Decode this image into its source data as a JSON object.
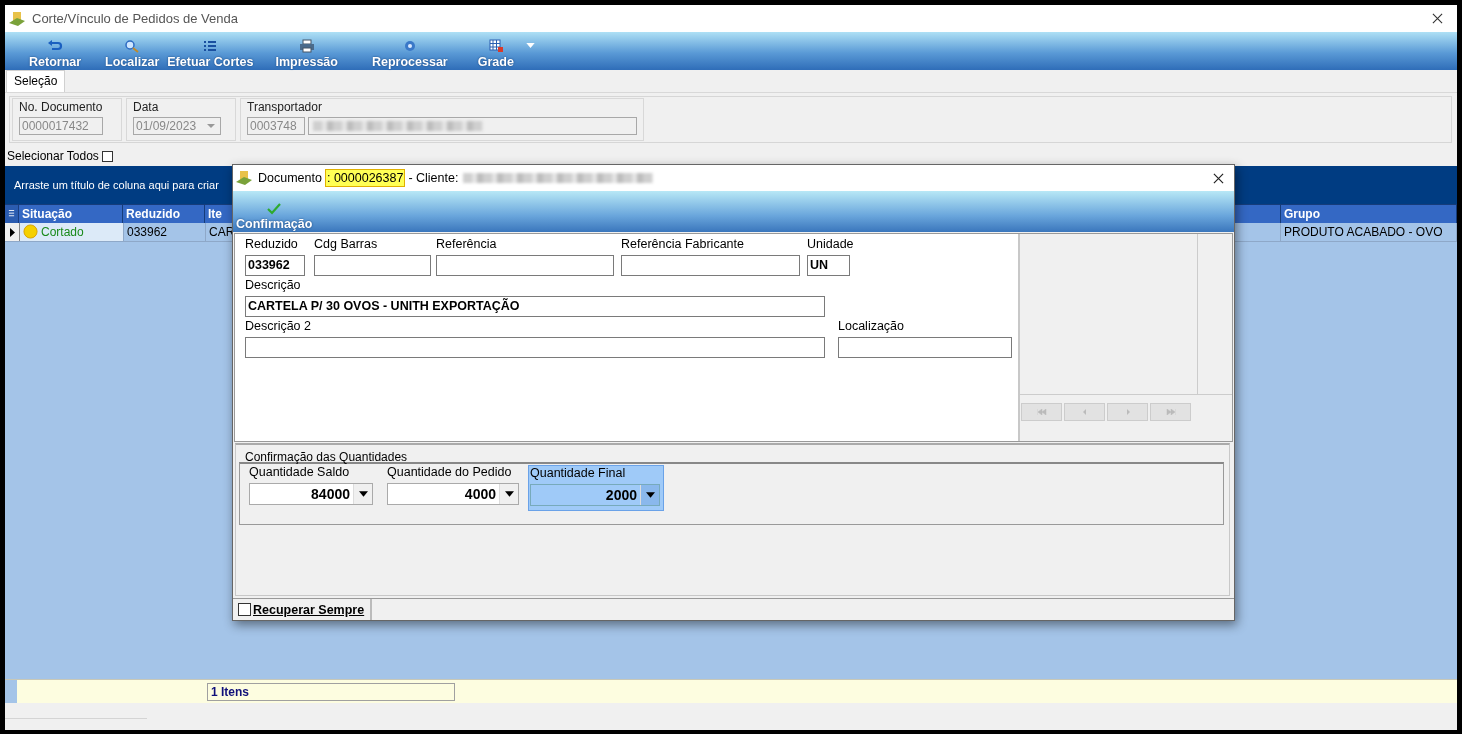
{
  "window": {
    "title": "Corte/Vínculo de Pedidos de Venda"
  },
  "toolbar": [
    {
      "label": "Retornar",
      "kind": "return"
    },
    {
      "label": "Localizar",
      "kind": "search"
    },
    {
      "label": "Efetuar Cortes",
      "kind": "list"
    },
    {
      "label": "Impressão",
      "kind": "print"
    },
    {
      "label": "Reprocessar",
      "kind": "gear"
    },
    {
      "label": "Grade",
      "kind": "grid"
    }
  ],
  "tabs": [
    {
      "label": "Seleção",
      "selected": true
    }
  ],
  "filters": {
    "disabled": true,
    "document": {
      "label": "No. Documento",
      "value": "0000017432"
    },
    "date": {
      "label": "Data",
      "value": "01/09/2023"
    },
    "carrier": {
      "label": "Transportador",
      "code": "0003748"
    }
  },
  "select_all": {
    "label": "Selecionar Todos",
    "checked": false
  },
  "group_hint": "Arraste um título de coluna aqui para criar",
  "grid": {
    "columns": [
      "Situação",
      "Reduzido",
      "Ite",
      "Grupo"
    ],
    "rows": [
      {
        "status": "Cortado",
        "reduzido": "033962",
        "item": "CAR",
        "grupo": "PRODUTO ACABADO - OVO",
        "selected": true
      }
    ]
  },
  "footer": {
    "count": "1 Itens"
  },
  "dialog": {
    "doc_label": "Documento",
    "doc_number": ": 0000026387",
    "client_label": "- Cliente:",
    "action": "Confirmação",
    "fields": [
      [
        {
          "label": "Reduzido",
          "value": "033962"
        },
        {
          "label": "Cdg Barras"
        },
        {
          "label": "Referência"
        },
        {
          "label": "Referência Fabricante"
        },
        {
          "label": "Unidade",
          "value": "UN"
        }
      ],
      [
        {
          "label": "Descrição",
          "value": "CARTELA P/ 30 OVOS - UNITH EXPORTAÇÃO"
        }
      ],
      [
        {
          "label": "Descrição 2"
        },
        {
          "label": "Localização"
        }
      ]
    ],
    "quantities": {
      "title": "Confirmação das Quantidades",
      "items": [
        {
          "label": "Quantidade Saldo",
          "value": "84000",
          "selected": false
        },
        {
          "label": "Quantidade do Pedido",
          "value": "4000",
          "selected": false
        },
        {
          "label": "Quantidade Final",
          "value": "2000",
          "selected": true
        }
      ]
    },
    "recover": {
      "label": "Recuperar Sempre",
      "checked": false
    }
  }
}
